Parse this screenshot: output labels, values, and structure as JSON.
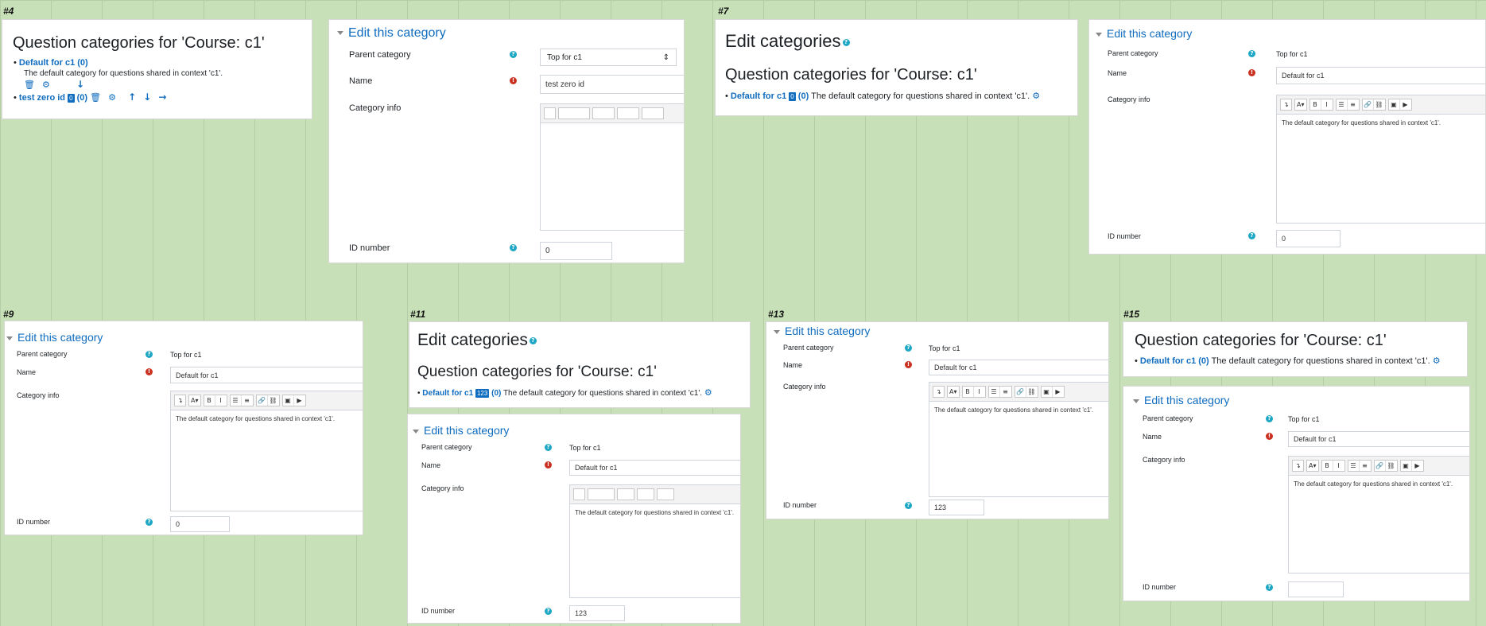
{
  "labels": {
    "s4": "#4",
    "s7": "#7",
    "s9": "#9",
    "s11": "#11",
    "s13": "#13",
    "s15": "#15"
  },
  "qcat_title": "Question categories for 'Course: c1'",
  "edit_categories": "Edit categories",
  "edit_this_category": "Edit this category",
  "fields": {
    "parent": "Parent category",
    "name": "Name",
    "info": "Category info",
    "idnumber": "ID number"
  },
  "parent_value": "Top for c1",
  "default_name": "Default for c1",
  "default_desc": "The default category for questions shared in context 'c1'.",
  "count": "(0)",
  "s4": {
    "cat1_link": "Default for c1 (0)",
    "cat2_link": "test zero id",
    "cat2_badge": "0",
    "name_value": "test zero id",
    "id_value": "0"
  },
  "s7": {
    "badge": "0",
    "id_value": "0"
  },
  "s9": {
    "id_value": "0"
  },
  "s11": {
    "badge": "123",
    "id_value": "123"
  },
  "s13": {
    "id_value": "123"
  },
  "s15": {
    "cat_link": "Default for c1 (0)",
    "id_value": ""
  },
  "toolbar": {
    "undo": "↴",
    "font": "A▾",
    "bold": "B",
    "italic": "I",
    "ul": "☰",
    "ol": "≡",
    "link": "🔗",
    "unlink": "⛓",
    "image": "▣",
    "media": "▶"
  },
  "colors": {
    "accent": "#0f6cbf",
    "background": "#c8e0b8",
    "help": "#1ea7c5",
    "required": "#ca3120"
  }
}
